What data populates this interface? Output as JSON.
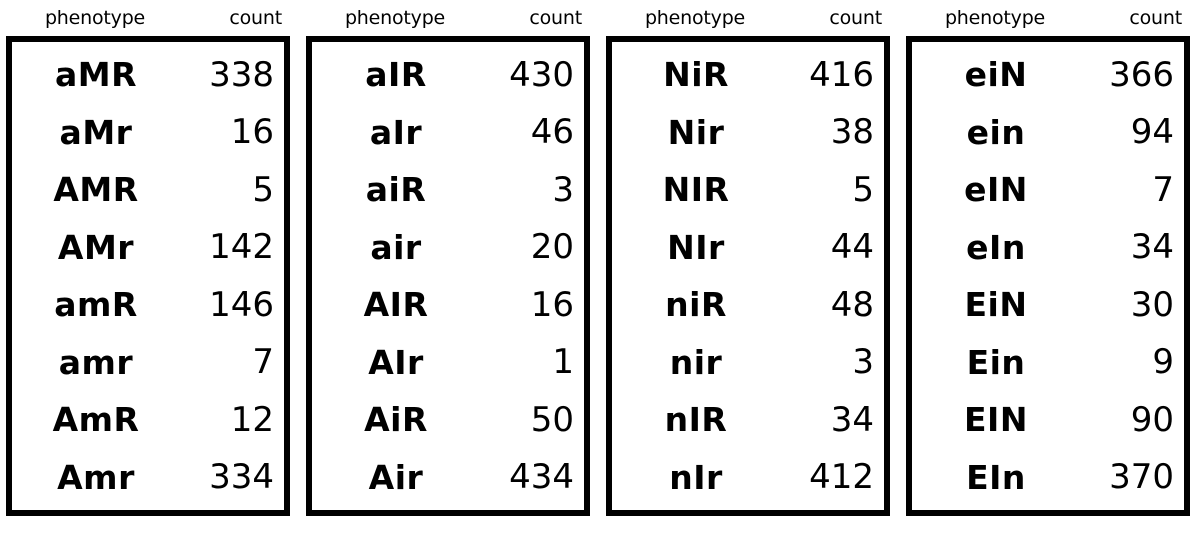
{
  "page": {
    "background_color": "#ffffff",
    "foreground_color": "#000000",
    "border_color": "#000000"
  },
  "tables": [
    {
      "id": "table-1",
      "headers": {
        "phenotype": "phenotype",
        "count": "count"
      },
      "rows": [
        {
          "phenotype": "aMR",
          "count": "338"
        },
        {
          "phenotype": "aMr",
          "count": "16"
        },
        {
          "phenotype": "AMR",
          "count": "5"
        },
        {
          "phenotype": "AMr",
          "count": "142"
        },
        {
          "phenotype": "amR",
          "count": "146"
        },
        {
          "phenotype": "amr",
          "count": "7"
        },
        {
          "phenotype": "AmR",
          "count": "12"
        },
        {
          "phenotype": "Amr",
          "count": "334"
        }
      ]
    },
    {
      "id": "table-2",
      "headers": {
        "phenotype": "phenotype",
        "count": "count"
      },
      "rows": [
        {
          "phenotype": "aIR",
          "count": "430"
        },
        {
          "phenotype": "aIr",
          "count": "46"
        },
        {
          "phenotype": "aiR",
          "count": "3"
        },
        {
          "phenotype": "air",
          "count": "20"
        },
        {
          "phenotype": "AIR",
          "count": "16"
        },
        {
          "phenotype": "AIr",
          "count": "1"
        },
        {
          "phenotype": "AiR",
          "count": "50"
        },
        {
          "phenotype": "Air",
          "count": "434"
        }
      ]
    },
    {
      "id": "table-3",
      "headers": {
        "phenotype": "phenotype",
        "count": "count"
      },
      "rows": [
        {
          "phenotype": "NiR",
          "count": "416"
        },
        {
          "phenotype": "Nir",
          "count": "38"
        },
        {
          "phenotype": "NIR",
          "count": "5"
        },
        {
          "phenotype": "NIr",
          "count": "44"
        },
        {
          "phenotype": "niR",
          "count": "48"
        },
        {
          "phenotype": "nir",
          "count": "3"
        },
        {
          "phenotype": "nIR",
          "count": "34"
        },
        {
          "phenotype": "nIr",
          "count": "412"
        }
      ]
    },
    {
      "id": "table-4",
      "headers": {
        "phenotype": "phenotype",
        "count": "count"
      },
      "rows": [
        {
          "phenotype": "eiN",
          "count": "366"
        },
        {
          "phenotype": "ein",
          "count": "94"
        },
        {
          "phenotype": "eIN",
          "count": "7"
        },
        {
          "phenotype": "eIn",
          "count": "34"
        },
        {
          "phenotype": "EiN",
          "count": "30"
        },
        {
          "phenotype": "Ein",
          "count": "9"
        },
        {
          "phenotype": "EIN",
          "count": "90"
        },
        {
          "phenotype": "EIn",
          "count": "370"
        }
      ]
    }
  ]
}
